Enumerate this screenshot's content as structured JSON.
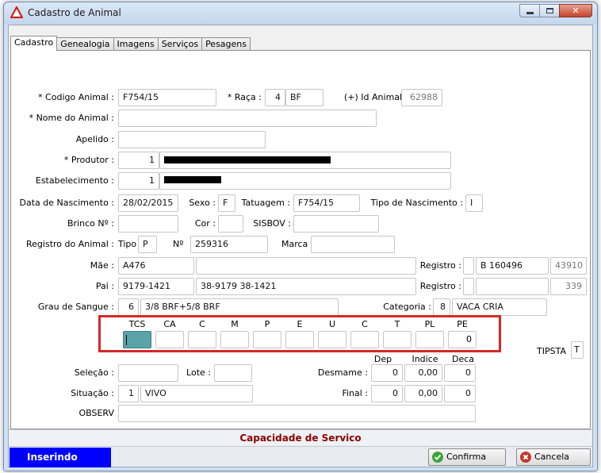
{
  "window": {
    "title": "Cadastro de Animal"
  },
  "tabs": [
    "Cadastro",
    "Genealogia",
    "Imagens",
    "Serviços",
    "Pesagens"
  ],
  "form": {
    "codigo_animal_label": "* Codigo Animal :",
    "codigo_animal": "F754/15",
    "raca_label": "* Raça :",
    "raca_codigo": "4",
    "raca_sigla": "BF",
    "id_animal_label": "(+) Id Animal",
    "id_animal": "62988",
    "nome_animal_label": "* Nome do Animal :",
    "nome_animal": "",
    "apelido_label": "Apelido :",
    "apelido": "",
    "produtor_label": "* Produtor :",
    "produtor_codigo": "1",
    "estabelecimento_label": "Estabelecimento :",
    "estabelecimento_codigo": "1",
    "data_nascimento_label": "Data de Nascimento :",
    "data_nascimento": "28/02/2015",
    "sexo_label": "Sexo :",
    "sexo": "F",
    "tatuagem_label": "Tatuagem :",
    "tatuagem": "F754/15",
    "tipo_nascimento_label": "Tipo de Nascimento :",
    "tipo_nascimento": "I",
    "brinco_label": "Brinco Nº :",
    "brinco": "",
    "cor_label": "Cor :",
    "cor": "",
    "sisbov_label": "SISBOV :",
    "sisbov": "",
    "registro_animal_label": "Registro do Animal :",
    "tipo_label": "Tipo",
    "tipo": "P",
    "numero_label": "Nº",
    "numero": "259316",
    "marca_label": "Marca",
    "marca": "",
    "mae_label": "Mãe :",
    "mae": "A476",
    "mae_nome": "",
    "registro_label": "Registro :",
    "mae_registro_tipo": "",
    "mae_registro": "B 160496",
    "mae_registro_id": "43910",
    "pai_label": "Pai :",
    "pai": "9179-1421",
    "pai_nome": "38-9179 38-1421",
    "pai_registro_tipo": "",
    "pai_registro": "",
    "pai_registro_id": "339",
    "grau_sangue_label": "Grau de Sangue :",
    "grau_sangue_codigo": "6",
    "grau_sangue": "3/8 BRF+5/8 BRF",
    "categoria_label": "Categoria :",
    "categoria_codigo": "8",
    "categoria": "VACA CRIA"
  },
  "capacidade": {
    "columns": [
      {
        "label": "TCS",
        "value": ""
      },
      {
        "label": "CA",
        "value": ""
      },
      {
        "label": "C",
        "value": ""
      },
      {
        "label": "M",
        "value": ""
      },
      {
        "label": "P",
        "value": ""
      },
      {
        "label": "E",
        "value": ""
      },
      {
        "label": "U",
        "value": ""
      },
      {
        "label": "C",
        "value": ""
      },
      {
        "label": "T",
        "value": ""
      },
      {
        "label": "PL",
        "value": ""
      },
      {
        "label": "PE",
        "value": "0"
      }
    ]
  },
  "tipsta": {
    "label": "TIPSTA",
    "value": "T"
  },
  "desmame": {
    "dep_label": "Dep",
    "indice_label": "Indice",
    "deca_label": "Deca",
    "desmame_label": "Desmame :",
    "desmame_dep": "0",
    "desmame_indice": "0,00",
    "desmame_deca": "0",
    "final_label": "Final :",
    "final_dep": "0",
    "final_indice": "0,00",
    "final_deca": "0"
  },
  "selecao": {
    "selecao_label": "Seleção :",
    "selecao": "",
    "lote_label": "Lote :",
    "lote": "",
    "situacao_label": "Situação :",
    "situacao_codigo": "1",
    "situacao": "VIVO",
    "observ_label": "OBSERV",
    "observ": ""
  },
  "footer": {
    "caption": "Capacidade de Servico",
    "mode": "Inserindo",
    "confirma_label": "Confirma",
    "cancela_label": "Cancela"
  },
  "colors": {
    "highlight_border": "#d62828",
    "mode_badge": "#0000ff",
    "caption_text": "#8b0000",
    "confirma_icon": "#3aa33a",
    "cancela_icon": "#c0392b"
  }
}
